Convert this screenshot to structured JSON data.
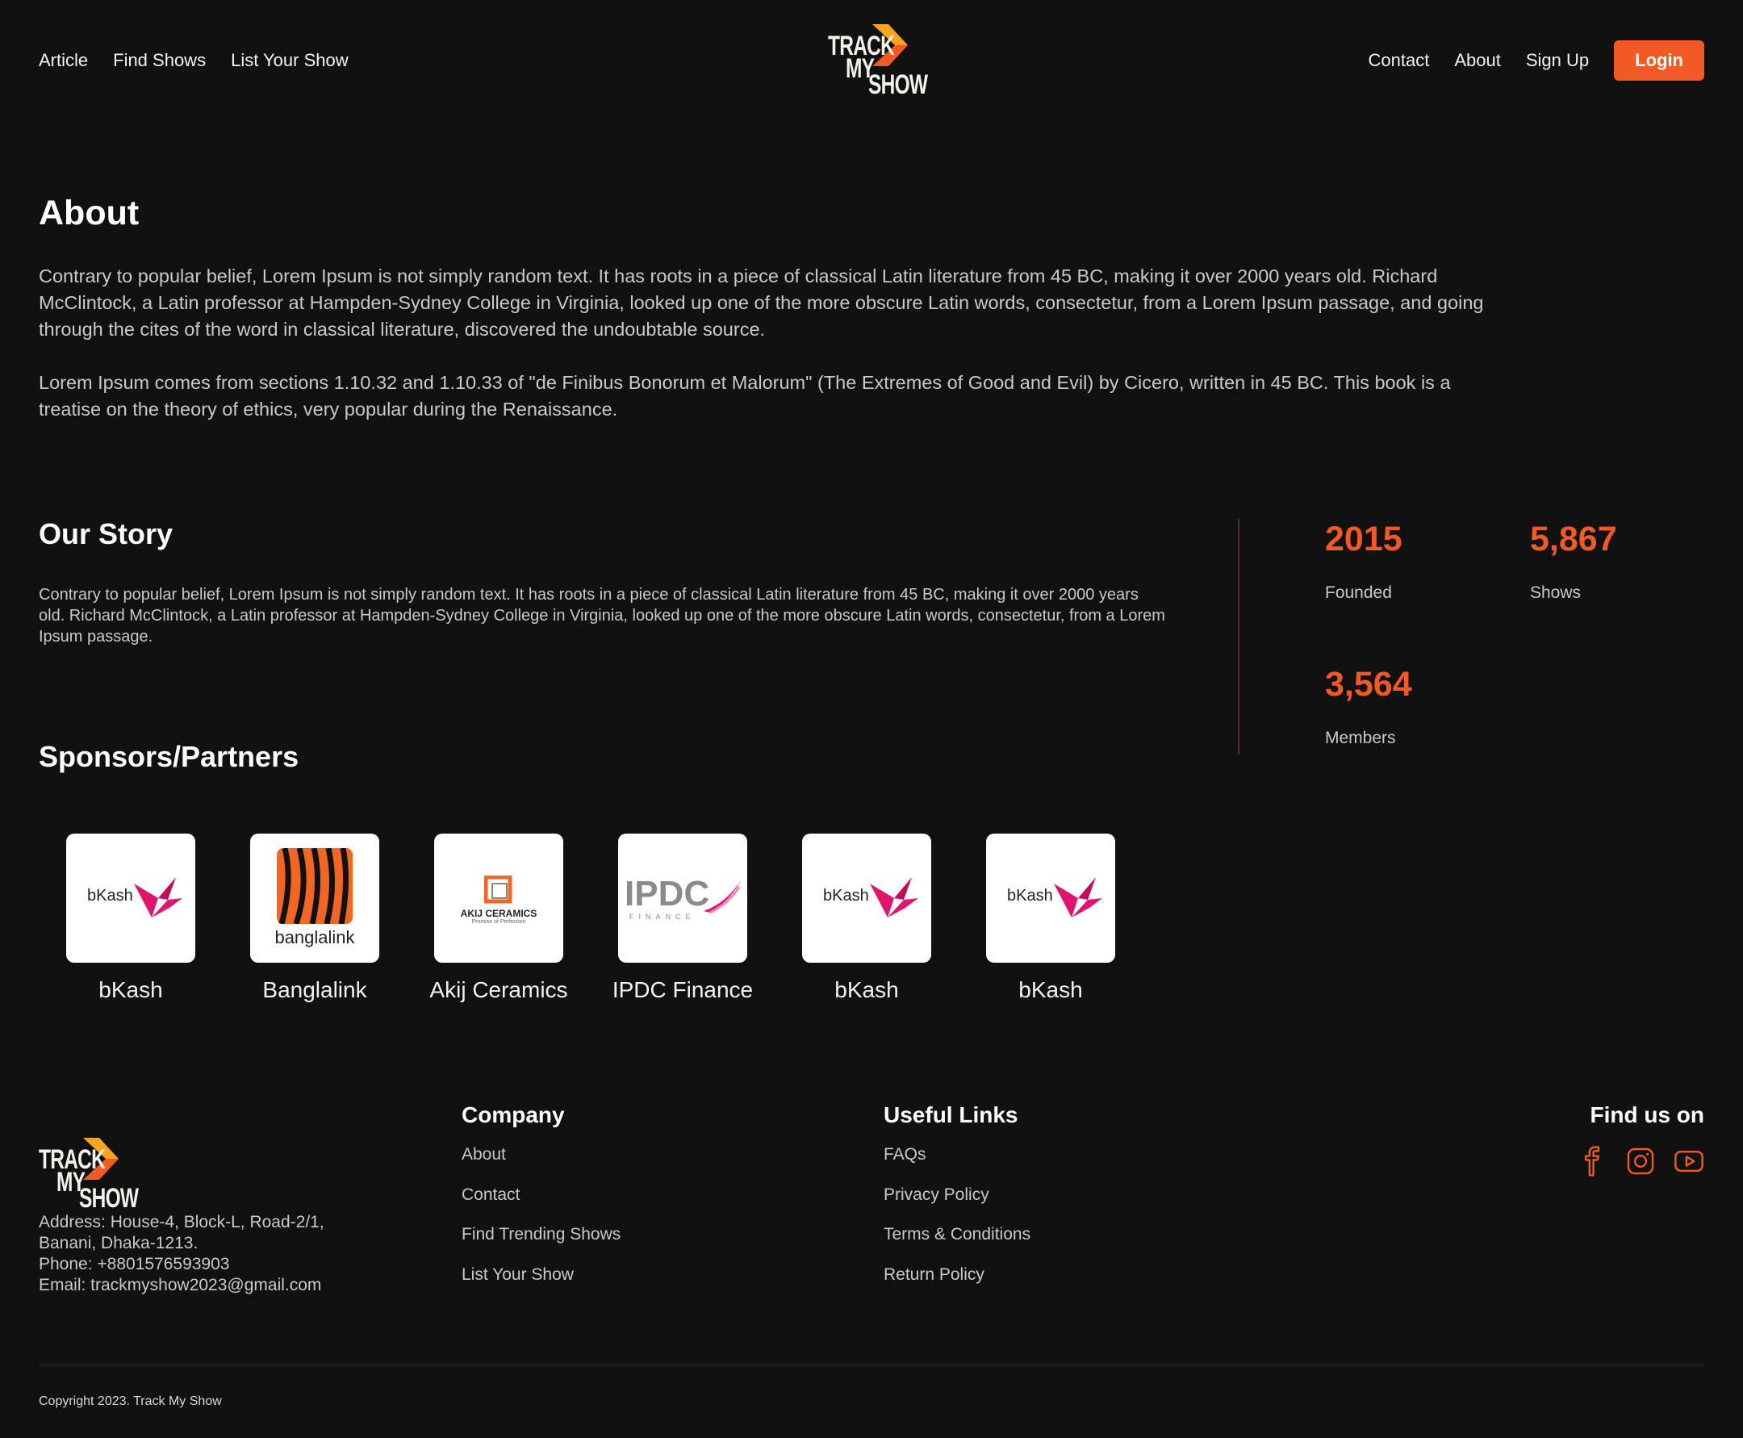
{
  "header": {
    "logo": {
      "line1": "TRACK",
      "line2": "MY",
      "line3": "SHOW"
    },
    "nav_left": [
      "Article",
      "Find Shows",
      "List Your Show"
    ],
    "nav_right": [
      "Contact",
      "About",
      "Sign Up"
    ],
    "login_label": "Login"
  },
  "about": {
    "title": "About",
    "para1": "Contrary to popular belief, Lorem Ipsum is not simply random text. It has roots in a piece of classical Latin literature from 45 BC, making it over 2000 years old. Richard McClintock, a Latin professor at Hampden-Sydney College in Virginia, looked up one of the more obscure Latin words, consectetur, from a Lorem Ipsum passage, and going through the cites of the word in classical literature, discovered the undoubtable source.",
    "para2": "Lorem Ipsum comes from sections 1.10.32 and 1.10.33 of \"de Finibus Bonorum et Malorum\" (The Extremes of Good and Evil) by Cicero, written in 45 BC. This book is a treatise on the theory of ethics, very popular during the Renaissance."
  },
  "story": {
    "title": "Our Story",
    "text": "Contrary to popular belief, Lorem Ipsum is not simply random text. It has roots in a piece of classical Latin literature from 45 BC, making it over 2000 years old. Richard McClintock, a Latin professor at Hampden-Sydney College in Virginia, looked up one of the more obscure Latin words, consectetur, from a Lorem Ipsum passage."
  },
  "stats": [
    {
      "value": "2015",
      "label": "Founded"
    },
    {
      "value": "5,867",
      "label": "Shows"
    },
    {
      "value": "3,564",
      "label": "Members"
    }
  ],
  "sponsors": {
    "title": "Sponsors/Partners",
    "items": [
      {
        "name": "bKash",
        "logo": "bkash"
      },
      {
        "name": "Banglalink",
        "logo": "banglalink",
        "logo_text": "banglalink"
      },
      {
        "name": "Akij Ceramics",
        "logo": "akij",
        "logo_text": "AKIJ CERAMICS",
        "logo_tagline": "Promise of Perfection"
      },
      {
        "name": "IPDC Finance",
        "logo": "ipdc",
        "logo_text": "IPDC",
        "logo_sub": "FINANCE"
      },
      {
        "name": "bKash",
        "logo": "bkash"
      },
      {
        "name": "bKash",
        "logo": "bkash"
      }
    ],
    "bkash_logo_text": "bKash"
  },
  "footer": {
    "address": {
      "line1": "Address: House-4, Block-L, Road-2/1,",
      "line2": "Banani, Dhaka-1213.",
      "line3": "Phone:  +8801576593903",
      "line4": "Email:  trackmyshow2023@gmail.com"
    },
    "company": {
      "title": "Company",
      "links": [
        "About",
        "Contact",
        "Find Trending Shows",
        "List Your Show"
      ]
    },
    "useful": {
      "title": "Useful Links",
      "links": [
        "FAQs",
        "Privacy Policy",
        "Terms & Conditions",
        "Return Policy"
      ]
    },
    "find_us": {
      "title": "Find us on",
      "icons": [
        "facebook-icon",
        "instagram-icon",
        "youtube-icon"
      ]
    },
    "copyright": "Copyright 2023. Track My Show"
  },
  "colors": {
    "accent": "#f25a24",
    "background": "#111112",
    "logo_arrow_top": "#f7a51f",
    "logo_arrow_bottom": "#f25a24"
  }
}
